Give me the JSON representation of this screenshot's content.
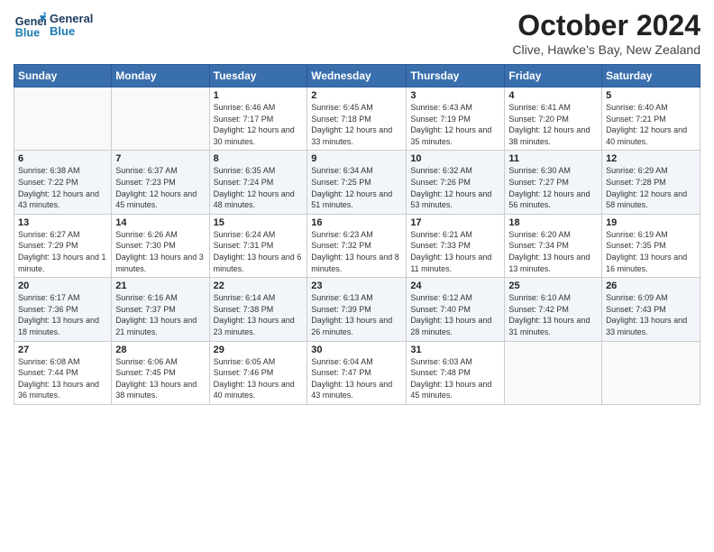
{
  "header": {
    "logo_line1": "General",
    "logo_line2": "Blue",
    "title": "October 2024",
    "subtitle": "Clive, Hawke's Bay, New Zealand"
  },
  "weekdays": [
    "Sunday",
    "Monday",
    "Tuesday",
    "Wednesday",
    "Thursday",
    "Friday",
    "Saturday"
  ],
  "weeks": [
    {
      "days": [
        {
          "num": "",
          "info": ""
        },
        {
          "num": "",
          "info": ""
        },
        {
          "num": "1",
          "info": "Sunrise: 6:46 AM\nSunset: 7:17 PM\nDaylight: 12 hours and 30 minutes."
        },
        {
          "num": "2",
          "info": "Sunrise: 6:45 AM\nSunset: 7:18 PM\nDaylight: 12 hours and 33 minutes."
        },
        {
          "num": "3",
          "info": "Sunrise: 6:43 AM\nSunset: 7:19 PM\nDaylight: 12 hours and 35 minutes."
        },
        {
          "num": "4",
          "info": "Sunrise: 6:41 AM\nSunset: 7:20 PM\nDaylight: 12 hours and 38 minutes."
        },
        {
          "num": "5",
          "info": "Sunrise: 6:40 AM\nSunset: 7:21 PM\nDaylight: 12 hours and 40 minutes."
        }
      ]
    },
    {
      "days": [
        {
          "num": "6",
          "info": "Sunrise: 6:38 AM\nSunset: 7:22 PM\nDaylight: 12 hours and 43 minutes."
        },
        {
          "num": "7",
          "info": "Sunrise: 6:37 AM\nSunset: 7:23 PM\nDaylight: 12 hours and 45 minutes."
        },
        {
          "num": "8",
          "info": "Sunrise: 6:35 AM\nSunset: 7:24 PM\nDaylight: 12 hours and 48 minutes."
        },
        {
          "num": "9",
          "info": "Sunrise: 6:34 AM\nSunset: 7:25 PM\nDaylight: 12 hours and 51 minutes."
        },
        {
          "num": "10",
          "info": "Sunrise: 6:32 AM\nSunset: 7:26 PM\nDaylight: 12 hours and 53 minutes."
        },
        {
          "num": "11",
          "info": "Sunrise: 6:30 AM\nSunset: 7:27 PM\nDaylight: 12 hours and 56 minutes."
        },
        {
          "num": "12",
          "info": "Sunrise: 6:29 AM\nSunset: 7:28 PM\nDaylight: 12 hours and 58 minutes."
        }
      ]
    },
    {
      "days": [
        {
          "num": "13",
          "info": "Sunrise: 6:27 AM\nSunset: 7:29 PM\nDaylight: 13 hours and 1 minute."
        },
        {
          "num": "14",
          "info": "Sunrise: 6:26 AM\nSunset: 7:30 PM\nDaylight: 13 hours and 3 minutes."
        },
        {
          "num": "15",
          "info": "Sunrise: 6:24 AM\nSunset: 7:31 PM\nDaylight: 13 hours and 6 minutes."
        },
        {
          "num": "16",
          "info": "Sunrise: 6:23 AM\nSunset: 7:32 PM\nDaylight: 13 hours and 8 minutes."
        },
        {
          "num": "17",
          "info": "Sunrise: 6:21 AM\nSunset: 7:33 PM\nDaylight: 13 hours and 11 minutes."
        },
        {
          "num": "18",
          "info": "Sunrise: 6:20 AM\nSunset: 7:34 PM\nDaylight: 13 hours and 13 minutes."
        },
        {
          "num": "19",
          "info": "Sunrise: 6:19 AM\nSunset: 7:35 PM\nDaylight: 13 hours and 16 minutes."
        }
      ]
    },
    {
      "days": [
        {
          "num": "20",
          "info": "Sunrise: 6:17 AM\nSunset: 7:36 PM\nDaylight: 13 hours and 18 minutes."
        },
        {
          "num": "21",
          "info": "Sunrise: 6:16 AM\nSunset: 7:37 PM\nDaylight: 13 hours and 21 minutes."
        },
        {
          "num": "22",
          "info": "Sunrise: 6:14 AM\nSunset: 7:38 PM\nDaylight: 13 hours and 23 minutes."
        },
        {
          "num": "23",
          "info": "Sunrise: 6:13 AM\nSunset: 7:39 PM\nDaylight: 13 hours and 26 minutes."
        },
        {
          "num": "24",
          "info": "Sunrise: 6:12 AM\nSunset: 7:40 PM\nDaylight: 13 hours and 28 minutes."
        },
        {
          "num": "25",
          "info": "Sunrise: 6:10 AM\nSunset: 7:42 PM\nDaylight: 13 hours and 31 minutes."
        },
        {
          "num": "26",
          "info": "Sunrise: 6:09 AM\nSunset: 7:43 PM\nDaylight: 13 hours and 33 minutes."
        }
      ]
    },
    {
      "days": [
        {
          "num": "27",
          "info": "Sunrise: 6:08 AM\nSunset: 7:44 PM\nDaylight: 13 hours and 36 minutes."
        },
        {
          "num": "28",
          "info": "Sunrise: 6:06 AM\nSunset: 7:45 PM\nDaylight: 13 hours and 38 minutes."
        },
        {
          "num": "29",
          "info": "Sunrise: 6:05 AM\nSunset: 7:46 PM\nDaylight: 13 hours and 40 minutes."
        },
        {
          "num": "30",
          "info": "Sunrise: 6:04 AM\nSunset: 7:47 PM\nDaylight: 13 hours and 43 minutes."
        },
        {
          "num": "31",
          "info": "Sunrise: 6:03 AM\nSunset: 7:48 PM\nDaylight: 13 hours and 45 minutes."
        },
        {
          "num": "",
          "info": ""
        },
        {
          "num": "",
          "info": ""
        }
      ]
    }
  ]
}
